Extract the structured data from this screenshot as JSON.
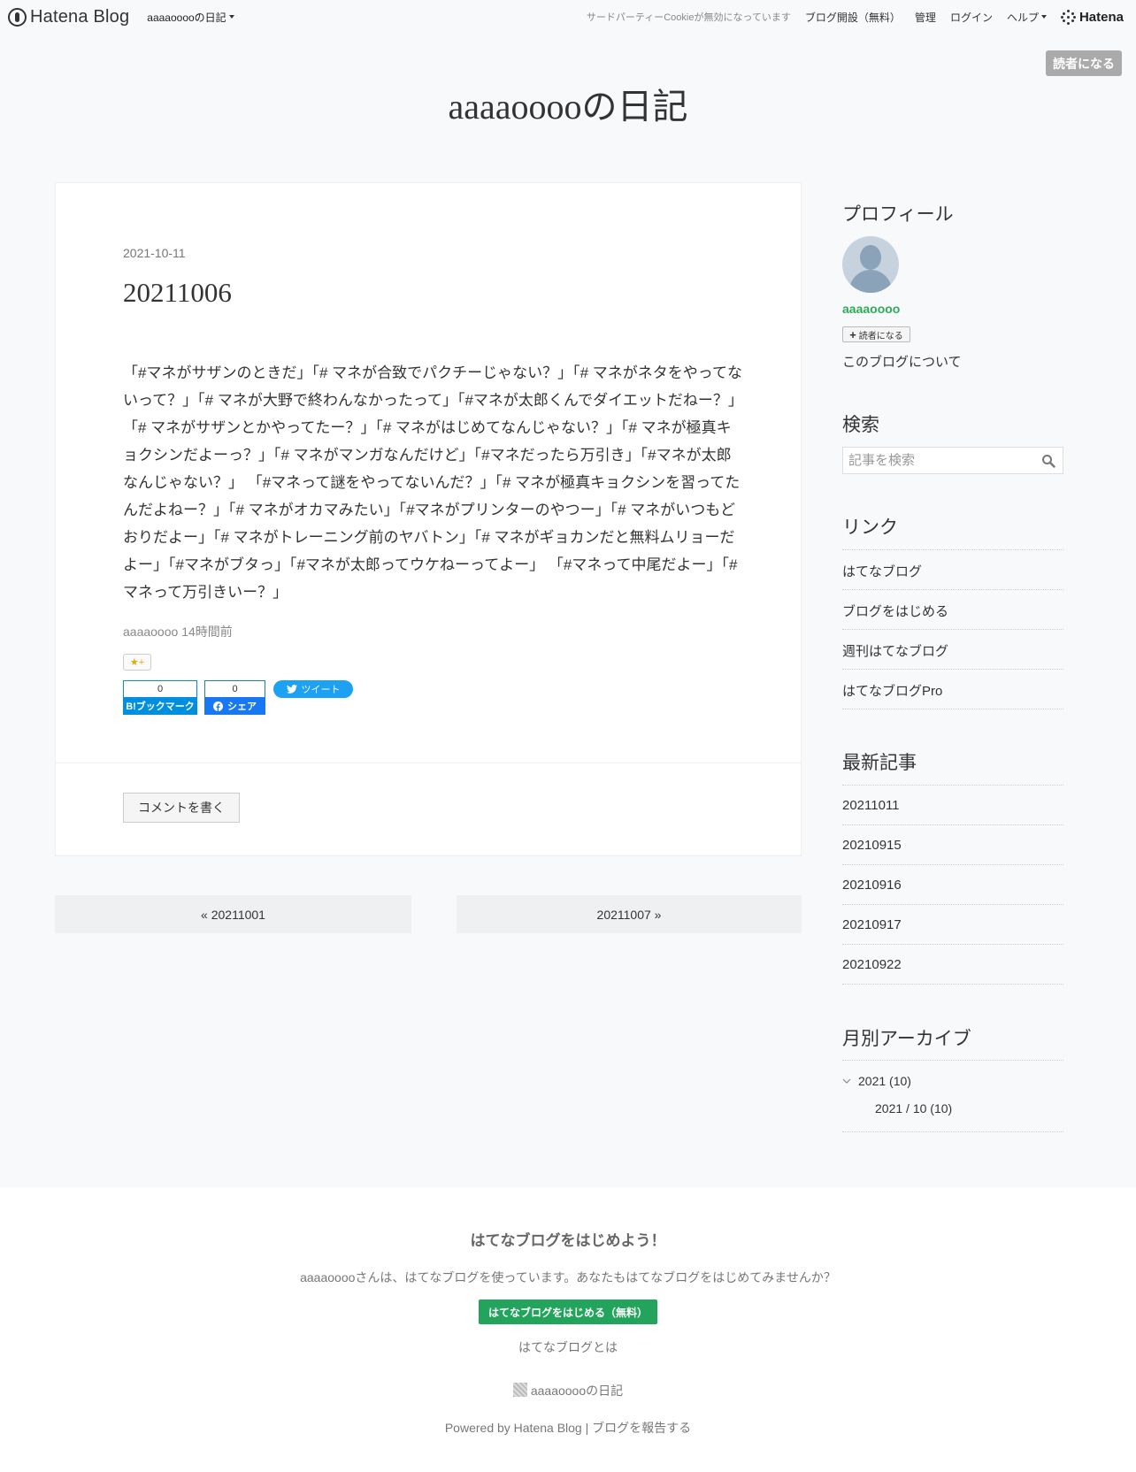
{
  "topbar": {
    "logo_text": "Hatena Blog",
    "blog_dropdown": "aaaaooooの日記",
    "cookie_notice": "サードパーティーCookieが無効になっています",
    "nav": [
      "ブログ開設（無料）",
      "管理",
      "ログイン",
      "ヘルプ"
    ],
    "brand": "Hatena"
  },
  "subscribe_label": "読者になる",
  "blog_title": "aaaaooooの日記",
  "article": {
    "date": "2021-10-11",
    "title": "20211006",
    "body": "「#マネがサザンのときだ」「# マネが合致でパクチーじゃない？」「# マネがネタをやってないって？」「# マネが大野で終わんなかったって」「#マネが太郎くんでダイエットだねー？」「# マネがサザンとかやってたー？」「# マネがはじめてなんじゃない？」「# マネが極真キョクシンだよーっ？」「# マネがマンガなんだけど」「#マネだったら万引き」「#マネが太郎なんじゃない？」 「#マネって謎をやってないんだ？」「# マネが極真キョクシンを習ってたんだよねー？」「# マネがオカマみたい」「#マネがプリンターのやつー」「# マネがいつもどおりだよー」「# マネがトレーニング前のヤバトン」「# マネがギョカンだと無料ムリョーだよー」「#マネがブタっ」「#マネが太郎ってウケねーってよー」 「#マネって中尾だよー」「#マネって万引きいー？」",
    "author": "aaaaoooo",
    "time_ago": "14時間前",
    "star_label": "★+",
    "bookmark_count": "0",
    "bookmark_label": "B!ブックマーク",
    "share_count": "0",
    "share_label": "シェア",
    "tweet_label": "ツイート",
    "comment_label": "コメントを書く"
  },
  "pager": {
    "prev": "« 20211001",
    "next": "20211007 »"
  },
  "sidebar": {
    "profile_heading": "プロフィール",
    "user_name": "aaaaoooo",
    "subscribe_small": "読者になる",
    "about": "このブログについて",
    "search_heading": "検索",
    "search_placeholder": "記事を検索",
    "links_heading": "リンク",
    "links": [
      "はてなブログ",
      "ブログをはじめる",
      "週刊はてなブログ",
      "はてなブログPro"
    ],
    "recent_heading": "最新記事",
    "recent": [
      "20211011",
      "20210915",
      "20210916",
      "20210917",
      "20210922"
    ],
    "archive_heading": "月別アーカイブ",
    "archive_year": "2021 (10)",
    "archive_month": "2021 / 10 (10)"
  },
  "footer": {
    "title": "はてなブログをはじめよう！",
    "desc": "aaaaooooさんは、はてなブログを使っています。あなたもはてなブログをはじめてみませんか？",
    "start_button": "はてなブログをはじめる（無料）",
    "what_is": "はてなブログとは",
    "blog_name": "aaaaooooの日記",
    "powered": "Powered by Hatena Blog",
    "separator": "|",
    "report": "ブログを報告する"
  },
  "colors": {
    "accent_green": "#2eaa5a",
    "bookmark_blue": "#008fde",
    "facebook_blue": "#1877f2",
    "twitter_blue": "#1da1f2"
  }
}
